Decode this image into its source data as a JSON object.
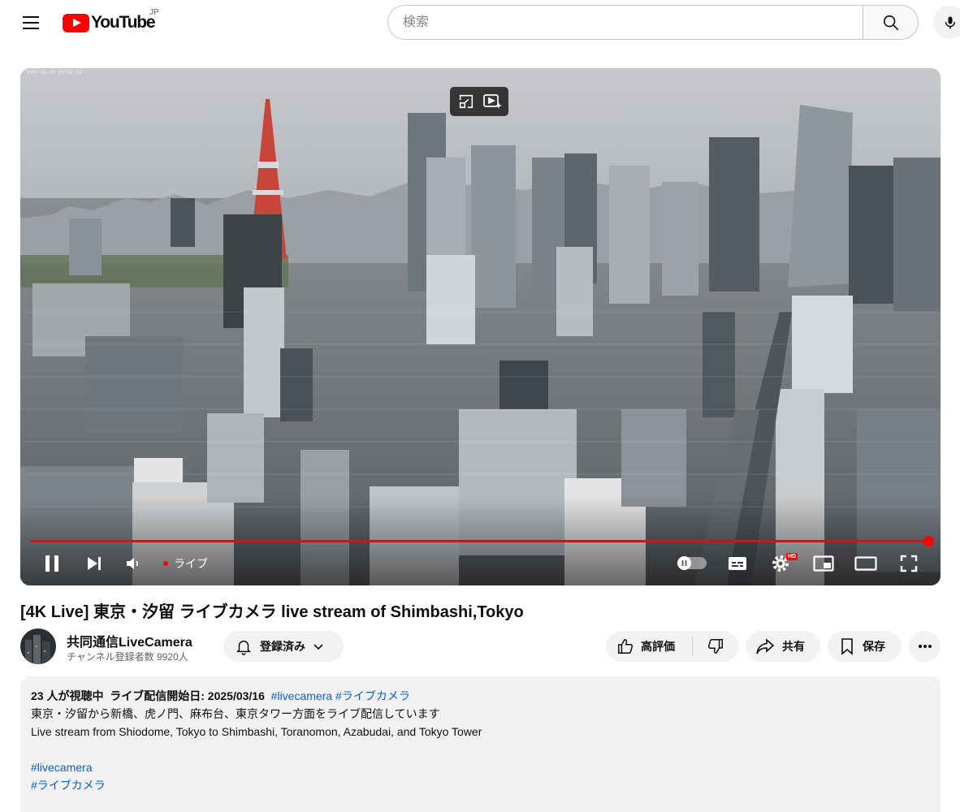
{
  "masthead": {
    "logo_text": "YouTube",
    "region": "JP",
    "search_placeholder": "検索"
  },
  "player": {
    "timestamp": "2025-04-24 09:02:34",
    "live_label": "ライブ",
    "hd_badge": "HD",
    "progress": 1.0,
    "accent_color": "#ff0000"
  },
  "video": {
    "title": "[4K Live] 東京・汐留 ライブカメラ live stream of Shimbashi,Tokyo"
  },
  "owner": {
    "channel_name": "共同通信LiveCamera",
    "subscribers": "チャンネル登録者数 9920人",
    "subscribe_label": "登録済み"
  },
  "actions": {
    "like_label": "高評価",
    "share_label": "共有",
    "save_label": "保存"
  },
  "description": {
    "viewers": "23 人が視聴中",
    "started": "ライブ配信開始日: 2025/03/16",
    "tag1": "#livecamera",
    "tag2": "#ライブカメラ",
    "line1": "東京・汐留から新橋、虎ノ門、麻布台、東京タワー方面をライブ配信しています",
    "line2": "Live stream from Shiodome, Tokyo to Shimbashi, Toranomon, Azabudai, and Tokyo Tower",
    "hashtag1": "#livecamera",
    "hashtag2": "#ライブカメラ"
  }
}
